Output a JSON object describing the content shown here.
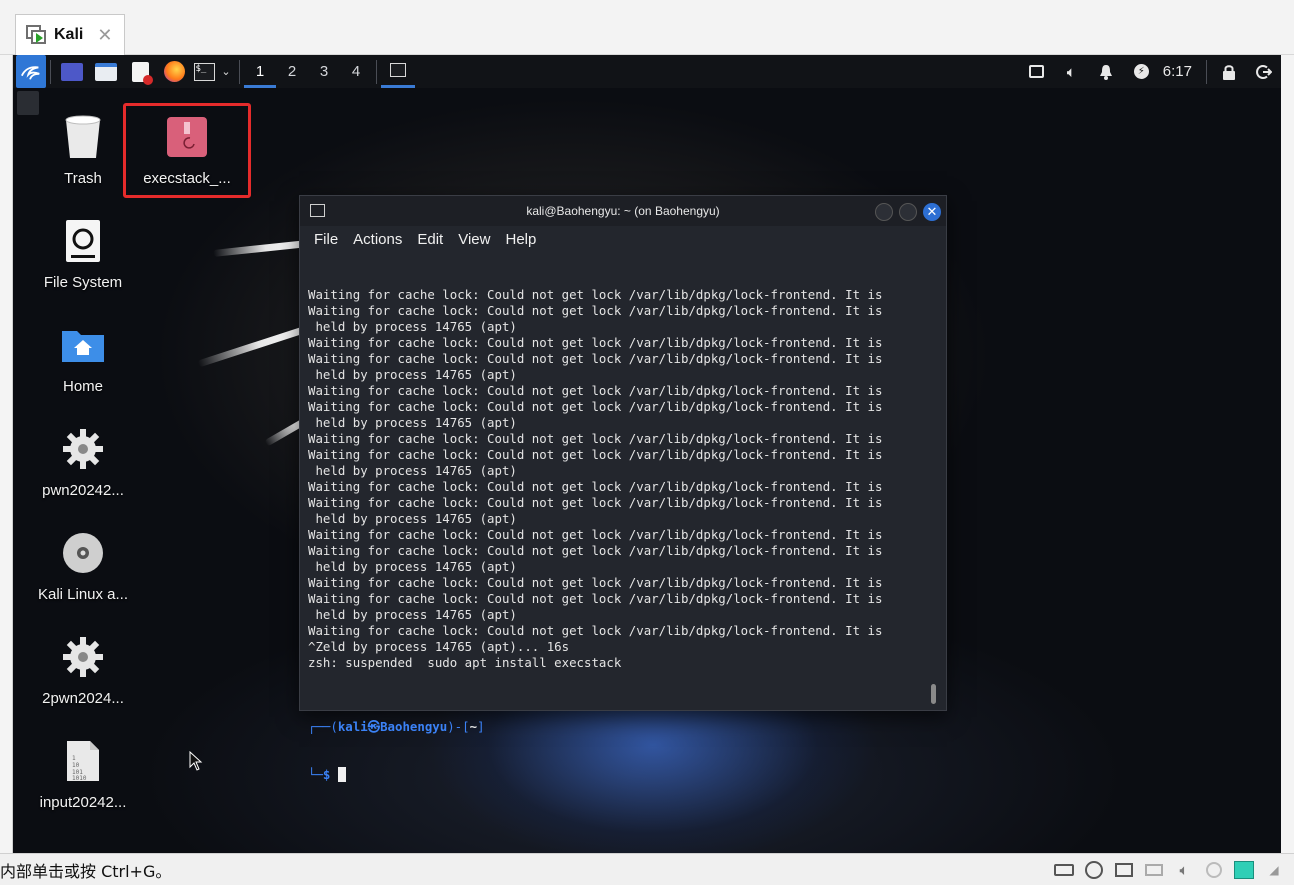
{
  "host": {
    "tab_title": "Kali",
    "tab_close": "✕",
    "status_message": "内部单击或按 Ctrl+G。"
  },
  "panel": {
    "workspaces": [
      "1",
      "2",
      "3",
      "4"
    ],
    "active_workspace": "1",
    "clock": "6:17"
  },
  "desktop": {
    "icons": [
      {
        "label": "Trash"
      },
      {
        "label": "execstack_..."
      },
      {
        "label": "File System"
      },
      {
        "label": "Home"
      },
      {
        "label": "pwn20242..."
      },
      {
        "label": "Kali Linux a..."
      },
      {
        "label": "2pwn2024..."
      },
      {
        "label": "input20242..."
      }
    ]
  },
  "terminal": {
    "title": "kali@Baohengyu: ~ (on Baohengyu)",
    "menu": [
      "File",
      "Actions",
      "Edit",
      "View",
      "Help"
    ],
    "lines": [
      "Waiting for cache lock: Could not get lock /var/lib/dpkg/lock-frontend. It is",
      "Waiting for cache lock: Could not get lock /var/lib/dpkg/lock-frontend. It is",
      " held by process 14765 (apt)",
      "Waiting for cache lock: Could not get lock /var/lib/dpkg/lock-frontend. It is",
      "Waiting for cache lock: Could not get lock /var/lib/dpkg/lock-frontend. It is",
      " held by process 14765 (apt)",
      "Waiting for cache lock: Could not get lock /var/lib/dpkg/lock-frontend. It is",
      "Waiting for cache lock: Could not get lock /var/lib/dpkg/lock-frontend. It is",
      " held by process 14765 (apt)",
      "Waiting for cache lock: Could not get lock /var/lib/dpkg/lock-frontend. It is",
      "Waiting for cache lock: Could not get lock /var/lib/dpkg/lock-frontend. It is",
      " held by process 14765 (apt)",
      "Waiting for cache lock: Could not get lock /var/lib/dpkg/lock-frontend. It is",
      "Waiting for cache lock: Could not get lock /var/lib/dpkg/lock-frontend. It is",
      " held by process 14765 (apt)",
      "Waiting for cache lock: Could not get lock /var/lib/dpkg/lock-frontend. It is",
      "Waiting for cache lock: Could not get lock /var/lib/dpkg/lock-frontend. It is",
      " held by process 14765 (apt)",
      "Waiting for cache lock: Could not get lock /var/lib/dpkg/lock-frontend. It is",
      "Waiting for cache lock: Could not get lock /var/lib/dpkg/lock-frontend. It is",
      " held by process 14765 (apt)",
      "Waiting for cache lock: Could not get lock /var/lib/dpkg/lock-frontend. It is",
      "^Zeld by process 14765 (apt)... 16s",
      "zsh: suspended  sudo apt install execstack",
      ""
    ],
    "prompt": {
      "line1_prefix": "┌──(",
      "user_host": "kali㉿Baohengyu",
      "line1_mid": ")-[",
      "cwd": "~",
      "line1_suffix": "]",
      "line2_prefix": "└─",
      "symbol": "$"
    }
  },
  "colors": {
    "accent": "#3a7bd5",
    "prompt_blue": "#3b82f6",
    "highlight_red": "#e52b2b"
  }
}
